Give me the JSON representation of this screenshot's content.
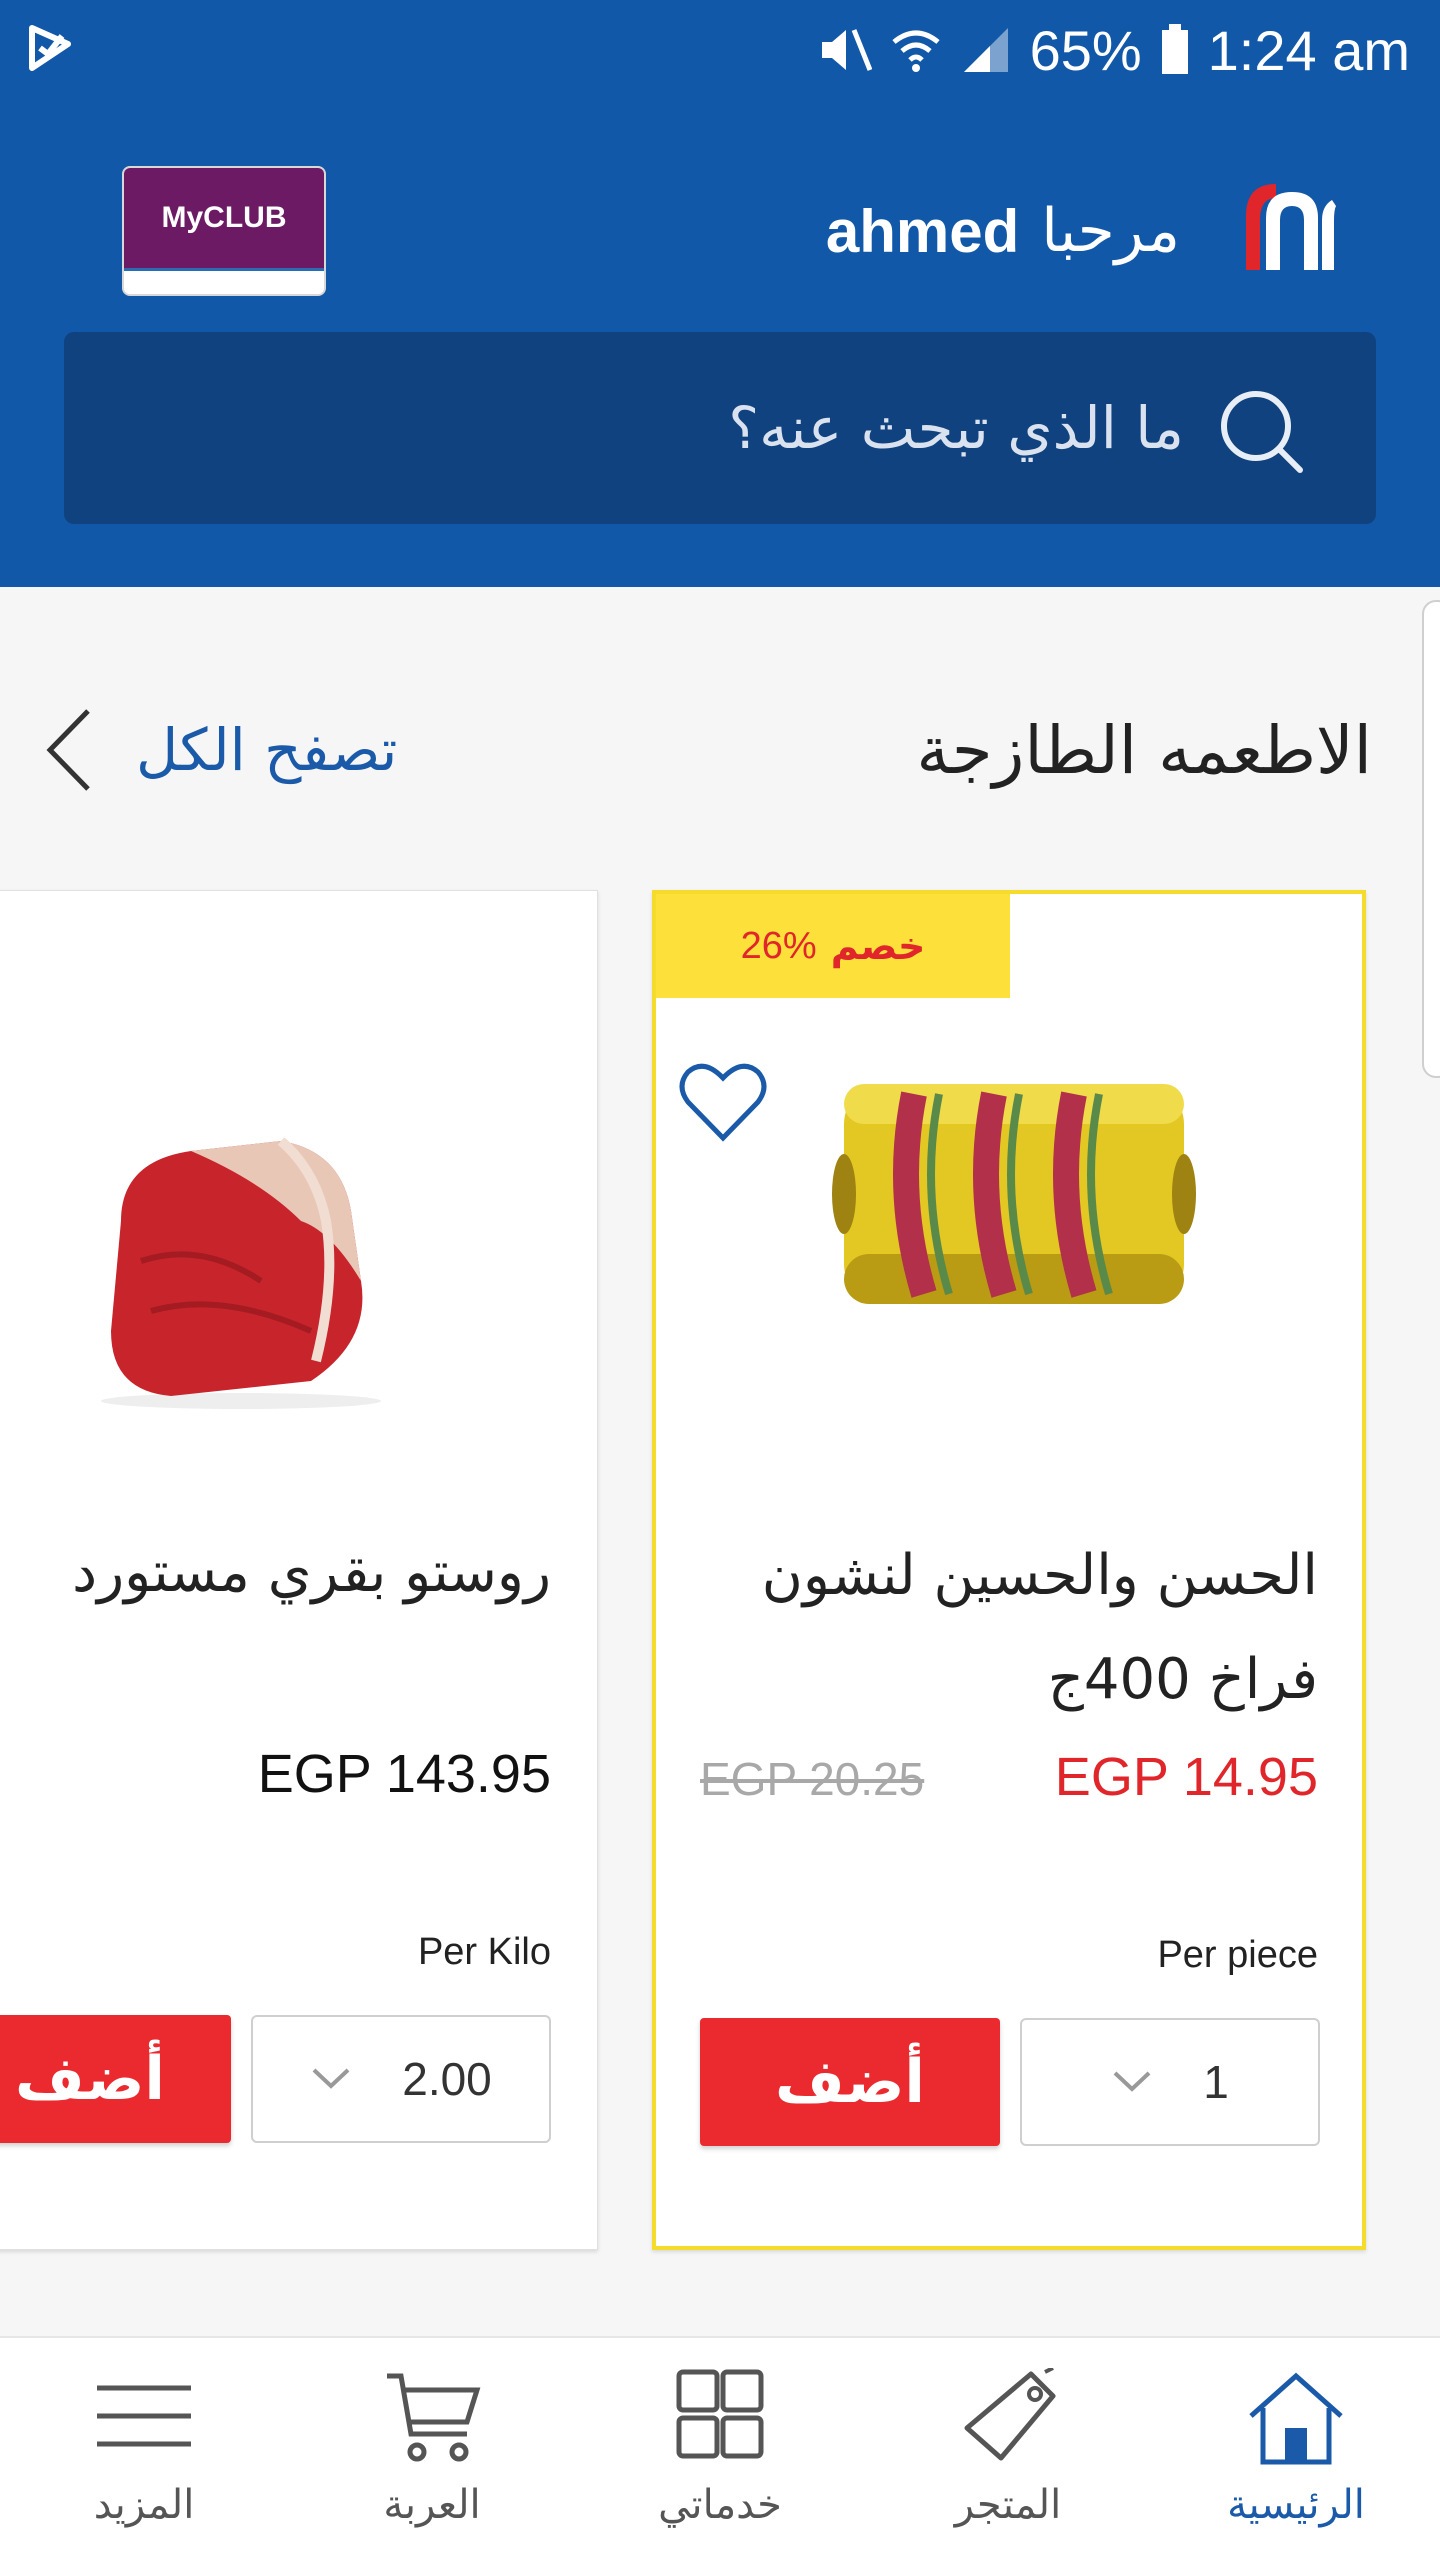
{
  "status_bar": {
    "battery": "65%",
    "time": "1:24 am"
  },
  "header": {
    "greeting": "مرحبا",
    "user_name": "ahmed",
    "myclub_label": "MyCLUB"
  },
  "search": {
    "placeholder": "ما الذي تبحث عنه؟"
  },
  "section": {
    "title": "الاطعمه الطازجة",
    "view_all": "تصفح الكل"
  },
  "products": [
    {
      "discount_percent": "26%",
      "discount_word": "خصم",
      "name": "الحسن والحسين لنشون فراخ 400ج",
      "price": "EGP 14.95",
      "old_price": "EGP 20.25",
      "unit": "Per piece",
      "quantity": "1",
      "add_label": "أضف"
    },
    {
      "name": "روستو بقري مستورد",
      "price": "EGP 143.95",
      "unit": "Per Kilo",
      "quantity": "2.00",
      "add_label": "أضف"
    }
  ],
  "bottom_nav": [
    {
      "label": "الرئيسية",
      "icon": "home-icon",
      "active": true
    },
    {
      "label": "المتجر",
      "icon": "tag-icon",
      "active": false
    },
    {
      "label": "خدماتي",
      "icon": "grid-icon",
      "active": false
    },
    {
      "label": "العربة",
      "icon": "cart-icon",
      "active": false
    },
    {
      "label": "المزيد",
      "icon": "menu-icon",
      "active": false
    }
  ],
  "colors": {
    "header_blue": "#1258a8",
    "search_blue": "#0f427f",
    "accent_red": "#ea2a2f",
    "discount_yellow": "#fde03a",
    "link_blue": "#1a5aa8"
  }
}
